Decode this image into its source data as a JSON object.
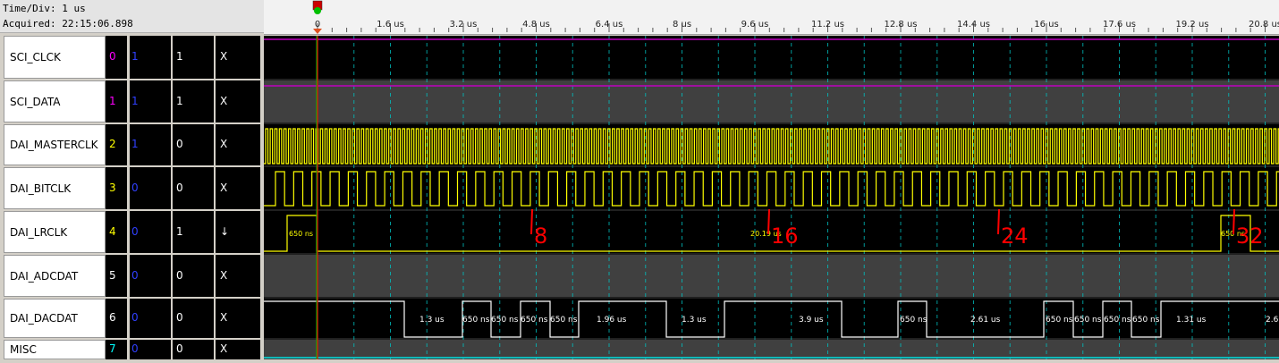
{
  "header": {
    "time_div": "Time/Div: 1 us",
    "acquired": "Acquired: 22:15:06.898"
  },
  "ruler": {
    "ticks": [
      "0",
      "1.6 us",
      "3.2 us",
      "4.8 us",
      "6.4 us",
      "8 us",
      "9.6 us",
      "11.2 us",
      "12.8 us",
      "14.4 us",
      "16 us",
      "17.6 us",
      "19.2 us",
      "20.8 us"
    ]
  },
  "channels": [
    {
      "name": "SCI_CLCK",
      "index": "0",
      "group": "1",
      "level": "1",
      "trigger": "X",
      "index_color": "#ff00ff"
    },
    {
      "name": "SCI_DATA",
      "index": "1",
      "group": "1",
      "level": "1",
      "trigger": "X",
      "index_color": "#ff00ff"
    },
    {
      "name": "DAI_MASTERCLK",
      "index": "2",
      "group": "1",
      "level": "0",
      "trigger": "X",
      "index_color": "#ffff00"
    },
    {
      "name": "DAI_BITCLK",
      "index": "3",
      "group": "0",
      "level": "0",
      "trigger": "X",
      "index_color": "#ffff00"
    },
    {
      "name": "DAI_LRCLK",
      "index": "4",
      "group": "0",
      "level": "1",
      "trigger": "↓",
      "index_color": "#ffff00"
    },
    {
      "name": "DAI_ADCDAT",
      "index": "5",
      "group": "0",
      "level": "0",
      "trigger": "X",
      "index_color": "#ffffff"
    },
    {
      "name": "DAI_DACDAT",
      "index": "6",
      "group": "0",
      "level": "0",
      "trigger": "X",
      "index_color": "#ffffff"
    },
    {
      "name": "MISC",
      "index": "7",
      "group": "0",
      "level": "0",
      "trigger": "X",
      "index_color": "#00ffff"
    }
  ],
  "lrclk_labels": [
    "650 ns",
    "20.19 us",
    "650 ns"
  ],
  "dacdat_labels": [
    "1.3 us",
    "650 ns",
    "650 ns",
    "650 ns",
    "650 ns",
    "1.96 us",
    "1.3 us",
    "3.9 us",
    "650 ns",
    "2.61 us",
    "650 ns",
    "650 ns",
    "650 ns",
    "650 ns",
    "1.31 us",
    "2.6"
  ],
  "annotations": [
    "8",
    "16",
    "24",
    "32"
  ],
  "colors": {
    "waveform": "#ffff00",
    "purple_line": "#c000c0",
    "cursor": "#ff0000",
    "trigger_marker": "#00c000",
    "grid": "#00c0c0",
    "annotation": "#ff0000"
  }
}
